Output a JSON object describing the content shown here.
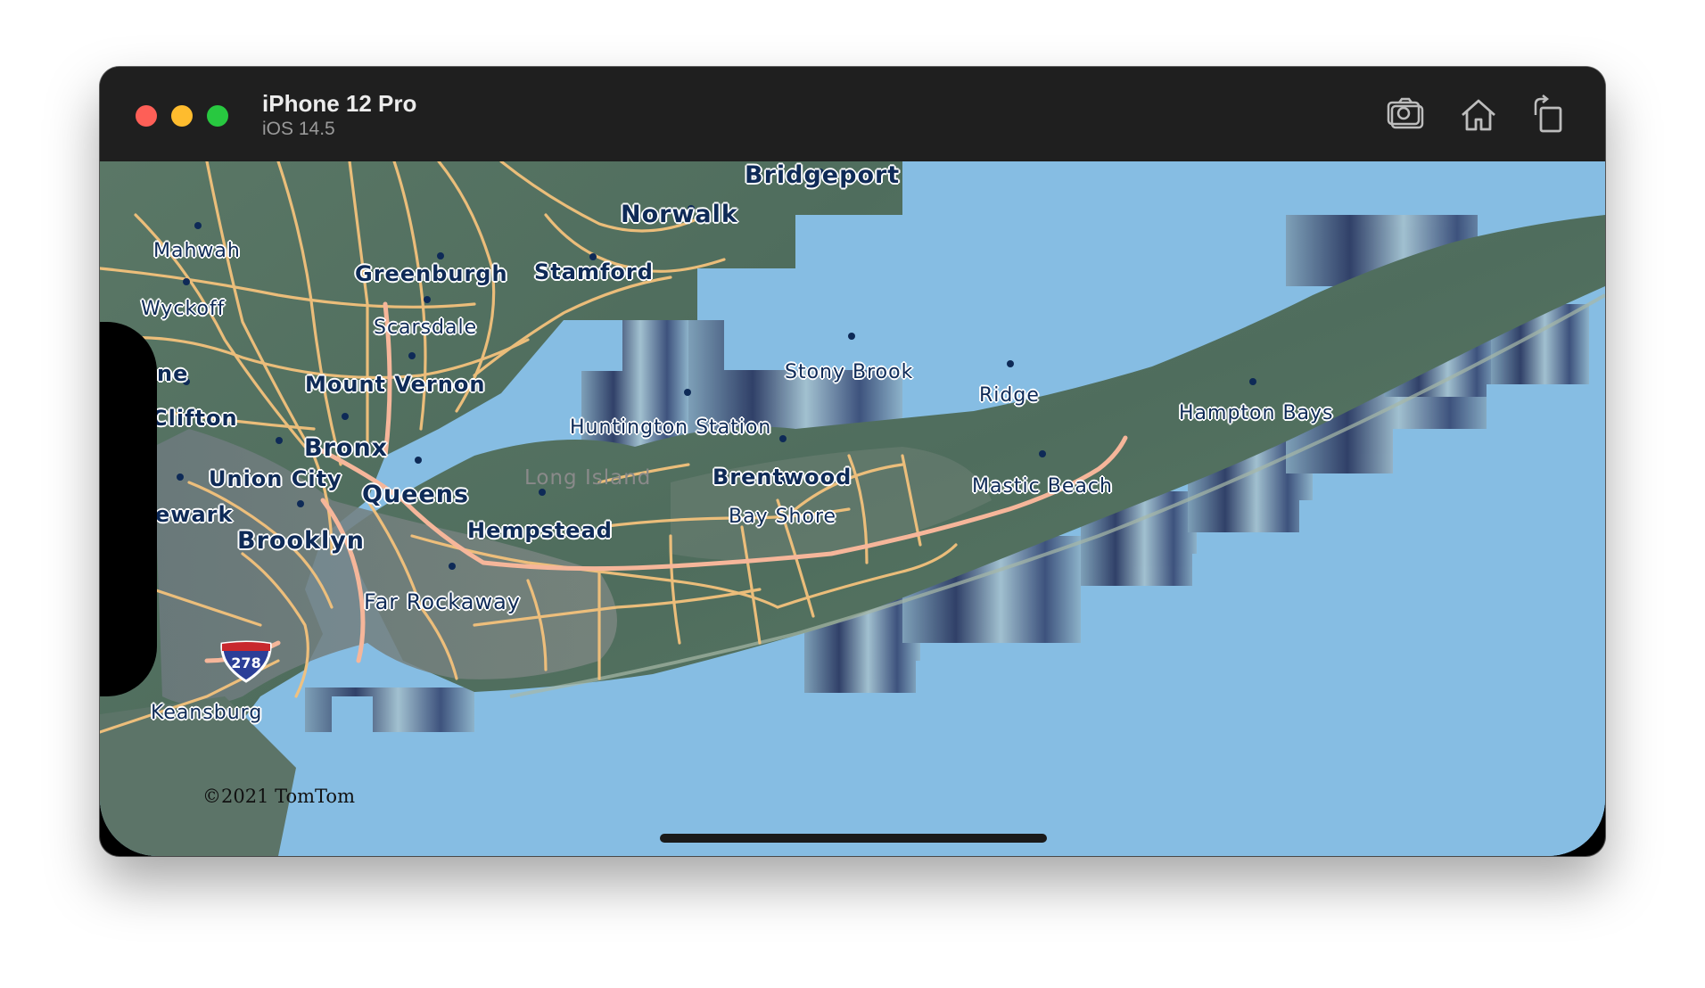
{
  "titlebar": {
    "device_name": "iPhone 12 Pro",
    "os_version": "iOS 14.5",
    "buttons": [
      {
        "name": "screenshot-button",
        "icon": "camera-icon"
      },
      {
        "name": "home-button",
        "icon": "home-icon"
      },
      {
        "name": "rotate-button",
        "icon": "rotate-icon"
      }
    ]
  },
  "map": {
    "water_color": "#86bde3",
    "labels": {
      "bridgeport": "Bridgeport",
      "norwalk": "Norwalk",
      "mahwah": "Mahwah",
      "greenburgh": "Greenburgh",
      "stamford": "Stamford",
      "wyckoff": "Wyckoff",
      "scarsdale": "Scarsdale",
      "ne": "ne",
      "mount_vernon": "Mount Vernon",
      "stony_brook": "Stony Brook",
      "ridge": "Ridge",
      "clifton": "Clifton",
      "hampton_bays": "Hampton Bays",
      "huntington_station": "Huntington Station",
      "bronx": "Bronx",
      "union_city": "Union City",
      "long_island": "Long Island",
      "brentwood": "Brentwood",
      "queens": "Queens",
      "mastic_beach": "Mastic Beach",
      "ewark": "ewark",
      "bay_shore": "Bay Shore",
      "hempstead": "Hempstead",
      "brooklyn": "Brooklyn",
      "far_rockaway": "Far Rockaway",
      "keansburg": "Keansburg"
    },
    "highway_shield": "278",
    "attribution": "©2021 TomTom"
  }
}
